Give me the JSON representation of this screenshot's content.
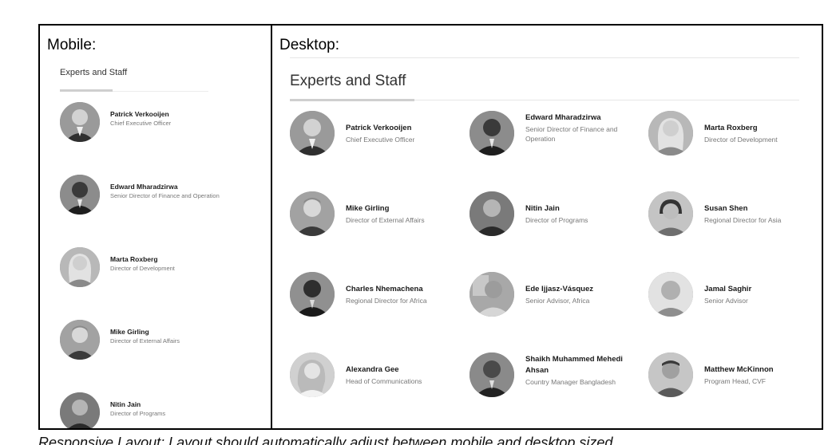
{
  "labels": {
    "mobile": "Mobile:",
    "desktop": "Desktop:"
  },
  "section_title": "Experts and Staff",
  "colors": {
    "accent": "#cfcfcf",
    "name": "#1a1a1a",
    "role": "#777777"
  },
  "mobile_staff": [
    {
      "name": "Patrick Verkooijen",
      "role": "Chief Executive Officer",
      "avatar": "person-photo-icon"
    },
    {
      "name": "Edward Mharadzirwa",
      "role": "Senior Director of Finance and Operation",
      "avatar": "person-photo-icon"
    },
    {
      "name": "Marta Roxberg",
      "role": "Director of Development",
      "avatar": "person-photo-icon"
    },
    {
      "name": "Mike Girling",
      "role": "Director of External Affairs",
      "avatar": "person-photo-icon"
    },
    {
      "name": "Nitin Jain",
      "role": "Director of Programs",
      "avatar": "person-photo-icon"
    }
  ],
  "desktop_staff": [
    {
      "name": "Patrick Verkooijen",
      "role": "Chief Executive Officer"
    },
    {
      "name": "Edward Mharadzirwa",
      "role": "Senior Director of Finance and Operation"
    },
    {
      "name": "Marta Roxberg",
      "role": "Director of Development"
    },
    {
      "name": "Mike Girling",
      "role": "Director of External Affairs"
    },
    {
      "name": "Nitin Jain",
      "role": "Director of Programs"
    },
    {
      "name": "Susan Shen",
      "role": "Regional Director for Asia"
    },
    {
      "name": "Charles Nhemachena",
      "role": "Regional Director for Africa"
    },
    {
      "name": "Ede Ijjasz-Vásquez",
      "role": "Senior Advisor, Africa"
    },
    {
      "name": "Jamal Saghir",
      "role": "Senior Advisor"
    },
    {
      "name": "Alexandra Gee",
      "role": "Head of Communications"
    },
    {
      "name": "Shaikh Muhammed Mehedi Ahsan",
      "role": "Country Manager Bangladesh"
    },
    {
      "name": "Matthew McKinnon",
      "role": "Program Head, CVF"
    }
  ],
  "caption": "Responsive Layout: Layout should automatically adjust between mobile and desktop sized"
}
